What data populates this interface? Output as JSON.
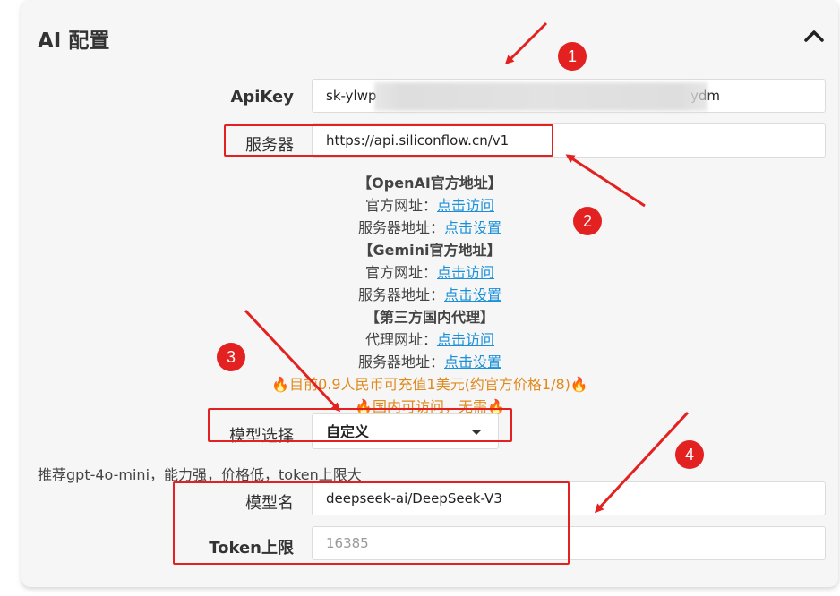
{
  "panel": {
    "title": "AI 配置"
  },
  "fields": {
    "apikey_label": "ApiKey",
    "apikey_prefix": "sk-ylwp",
    "apikey_suffix": "ydm",
    "server_label": "服务器",
    "server_value": "https://api.siliconflow.cn/v1",
    "model_select_label": "模型选择",
    "model_select_value": "自定义",
    "model_name_label": "模型名",
    "model_name_value": "deepseek-ai/DeepSeek-V3",
    "token_label": "Token上限",
    "token_placeholder": "16385"
  },
  "info": {
    "openai_heading": "【OpenAI官方地址】",
    "official_site_label": "官方网址：",
    "visit_link": "点击访问",
    "server_addr_label": "服务器地址：",
    "set_link": "点击设置",
    "gemini_heading": "【Gemini官方地址】",
    "third_party_heading": "【第三方国内代理】",
    "proxy_site_label": "代理网址：",
    "promo_line1": "🔥目前0.9人民币可充值1美元(约官方价格1/8)🔥",
    "promo_line2": "🔥国内可访问，无需🔥"
  },
  "hint": "推荐gpt-4o-mini，能力强，价格低，token上限大",
  "annotations": {
    "badges": [
      "1",
      "2",
      "3",
      "4"
    ],
    "color": "#e42121"
  },
  "colors": {
    "link": "#1a90d8",
    "promo": "#e08a1e",
    "panel_bg": "#f6f6f6"
  },
  "icons": {
    "collapse": "chevron-up-icon",
    "select_caret": "caret-down-icon"
  }
}
